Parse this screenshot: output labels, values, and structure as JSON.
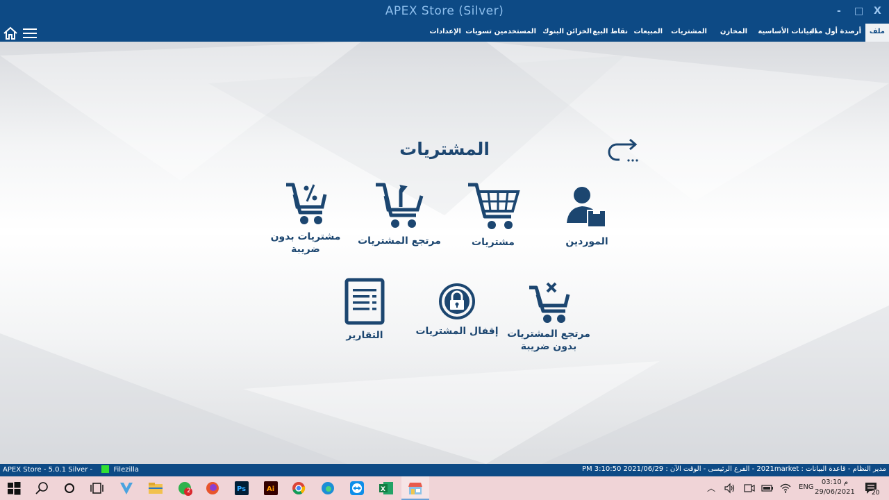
{
  "window": {
    "title": "APEX Store (Silver)",
    "minimize_glyph": "-",
    "maximize_glyph": "□",
    "close_glyph": "X"
  },
  "menu": {
    "items": [
      {
        "label": "ملف",
        "active": true
      },
      {
        "label": "أرصدة أول مدة"
      },
      {
        "label": "البيانات الأساسية"
      },
      {
        "label": "المخازن"
      },
      {
        "label": "المشتريات"
      },
      {
        "label": "المبيعات"
      },
      {
        "label": "نقاط البيع"
      },
      {
        "label": "الخزائن"
      },
      {
        "label": "البنوك"
      },
      {
        "label": "المستخدمين"
      },
      {
        "label": "تسويات"
      },
      {
        "label": "الإعدادات"
      }
    ]
  },
  "page": {
    "title": "المشتريات",
    "back_icon": "redo-arrow-icon"
  },
  "tiles": {
    "suppliers": {
      "label": "الموردين",
      "icon": "supplier-icon"
    },
    "purchases": {
      "label": "مشتريات",
      "icon": "cart-icon"
    },
    "purchase_returns": {
      "label": "مرتجع المشتريات",
      "icon": "cart-return-icon"
    },
    "purchases_no_tax_1": "مشتريات بدون",
    "purchases_no_tax_2": "ضريبة",
    "returns_no_tax_1": "مرتجع المشتريات",
    "returns_no_tax_2": "بدون ضريبة",
    "close_purchases": {
      "label": "إقفال المشتريات",
      "icon": "lock-icon"
    },
    "reports": {
      "label": "التقارير",
      "icon": "report-icon"
    }
  },
  "statusbar": {
    "version": "APEX Store - 5.0.1  Silver  -",
    "filezilla": "Filezilla",
    "info": "مدير النظام  -  قاعدة البيانات : 2021market  -  الفرع الرئيسى  -  الوقت الآن : PM 3:10:50 2021/06/29"
  },
  "taskbar": {
    "chat_badge": "2",
    "lang": "ENG",
    "time": "03:10 م",
    "date": "29/06/2021",
    "notifications": "20"
  },
  "colors": {
    "brand": "#0d4a85",
    "icon": "#1c4670"
  }
}
